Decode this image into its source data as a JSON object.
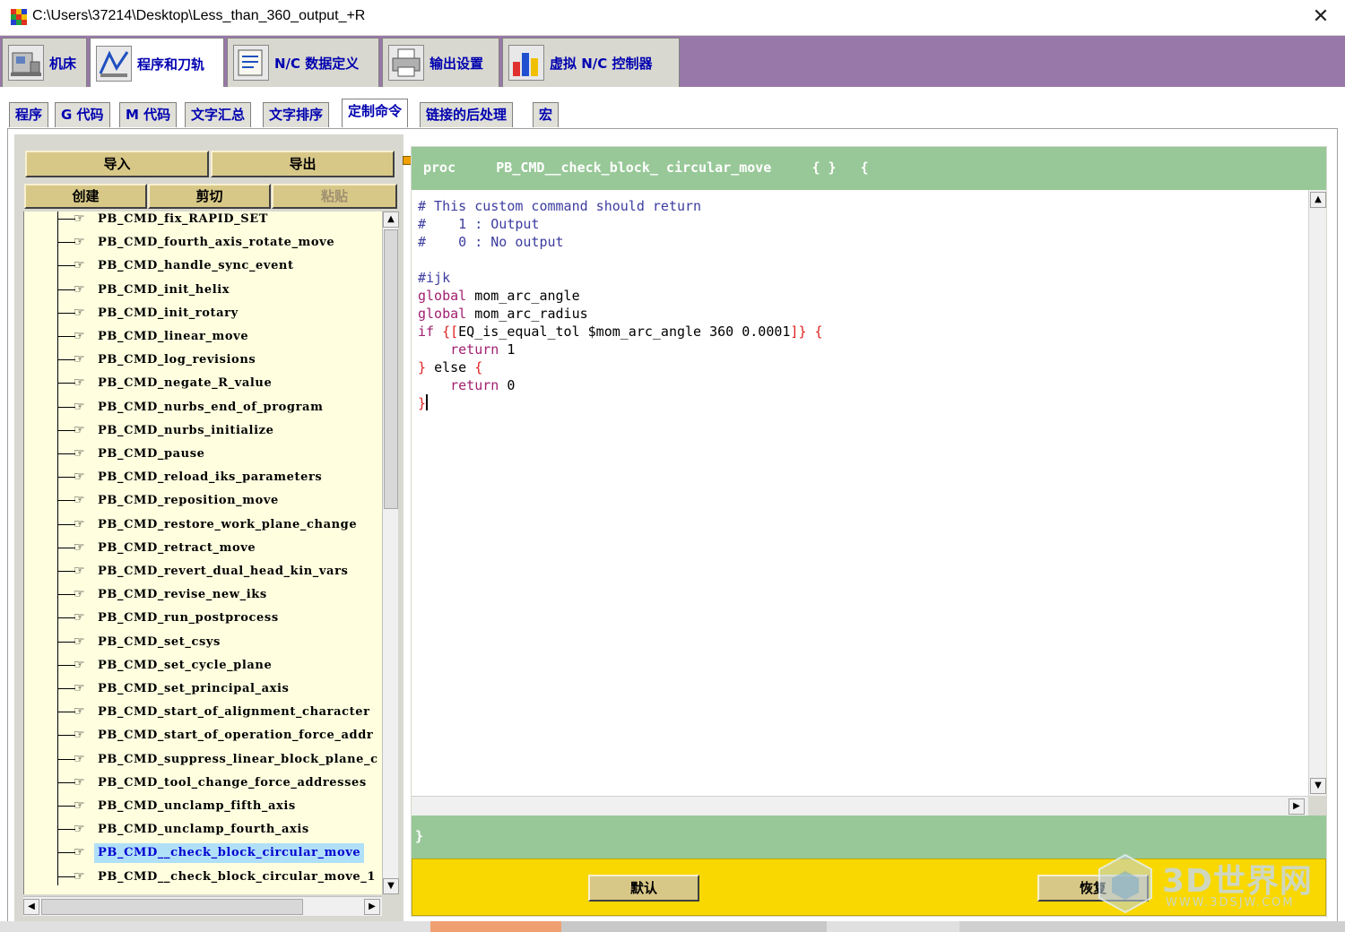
{
  "window": {
    "title": "C:\\Users\\37214\\Desktop\\Less_than_360_output_+R",
    "close_glyph": "✕"
  },
  "main_tabs": [
    {
      "label": "机床",
      "icon": "machine-tool-icon"
    },
    {
      "label": "程序和刀轨",
      "icon": "program-path-icon",
      "active": true
    },
    {
      "label": "N/C 数据定义",
      "icon": "nc-data-icon"
    },
    {
      "label": "输出设置",
      "icon": "printer-icon"
    },
    {
      "label": "虚拟 N/C 控制器",
      "icon": "virtual-controller-icon"
    }
  ],
  "sub_tabs": [
    {
      "label": "程序"
    },
    {
      "label": "G 代码"
    },
    {
      "label": "M 代码"
    },
    {
      "label": "文字汇总"
    },
    {
      "label": "文字排序"
    },
    {
      "label": "定制命令",
      "active": true
    },
    {
      "label": "链接的后处理"
    },
    {
      "label": "宏"
    }
  ],
  "left_panel": {
    "import_label": "导入",
    "export_label": "导出",
    "create_label": "创建",
    "cut_label": "剪切",
    "paste_label": "粘贴",
    "tree_items": [
      "PB_CMD_fix_RAPID_SET",
      "PB_CMD_fourth_axis_rotate_move",
      "PB_CMD_handle_sync_event",
      "PB_CMD_init_helix",
      "PB_CMD_init_rotary",
      "PB_CMD_linear_move",
      "PB_CMD_log_revisions",
      "PB_CMD_negate_R_value",
      "PB_CMD_nurbs_end_of_program",
      "PB_CMD_nurbs_initialize",
      "PB_CMD_pause",
      "PB_CMD_reload_iks_parameters",
      "PB_CMD_reposition_move",
      "PB_CMD_restore_work_plane_change",
      "PB_CMD_retract_move",
      "PB_CMD_revert_dual_head_kin_vars",
      "PB_CMD_revise_new_iks",
      "PB_CMD_run_postprocess",
      "PB_CMD_set_csys",
      "PB_CMD_set_cycle_plane",
      "PB_CMD_set_principal_axis",
      "PB_CMD_start_of_alignment_character",
      "PB_CMD_start_of_operation_force_addr",
      "PB_CMD_suppress_linear_block_plane_c",
      "PB_CMD_tool_change_force_addresses",
      "PB_CMD_unclamp_fifth_axis",
      "PB_CMD_unclamp_fourth_axis",
      "PB_CMD__check_block_circular_move",
      "PB_CMD__check_block_circular_move_1"
    ],
    "selected_index": 27
  },
  "editor": {
    "header": "proc     PB_CMD__check_block_ circular_move     { }   {",
    "lines": [
      {
        "parts": [
          {
            "t": "# This custom command should return",
            "c": "c-comment"
          }
        ]
      },
      {
        "parts": [
          {
            "t": "#    1 : Output",
            "c": "c-comment"
          }
        ]
      },
      {
        "parts": [
          {
            "t": "#    0 : No output",
            "c": "c-comment"
          }
        ]
      },
      {
        "parts": [
          {
            "t": "",
            "c": "c-var"
          }
        ]
      },
      {
        "parts": [
          {
            "t": "#ijk",
            "c": "c-comment"
          }
        ]
      },
      {
        "parts": [
          {
            "t": "global ",
            "c": "c-kw"
          },
          {
            "t": "mom_arc_angle",
            "c": "c-var"
          }
        ]
      },
      {
        "parts": [
          {
            "t": "global ",
            "c": "c-kw"
          },
          {
            "t": "mom_arc_radius",
            "c": "c-var"
          }
        ]
      },
      {
        "parts": [
          {
            "t": "if ",
            "c": "c-kw"
          },
          {
            "t": "{[",
            "c": "c-brace"
          },
          {
            "t": "EQ_is_equal_tol $mom_arc_angle 360 0.0001",
            "c": "c-var"
          },
          {
            "t": "]} {",
            "c": "c-brace"
          }
        ]
      },
      {
        "parts": [
          {
            "t": "    return ",
            "c": "c-kw"
          },
          {
            "t": "1",
            "c": "c-num"
          }
        ]
      },
      {
        "parts": [
          {
            "t": "} ",
            "c": "c-brace"
          },
          {
            "t": "else ",
            "c": "c-var"
          },
          {
            "t": "{",
            "c": "c-brace"
          }
        ]
      },
      {
        "parts": [
          {
            "t": "    return ",
            "c": "c-kw"
          },
          {
            "t": "0",
            "c": "c-num"
          }
        ]
      },
      {
        "parts": [
          {
            "t": "}",
            "c": "c-brace"
          }
        ],
        "cursor": true
      }
    ],
    "footer": "}"
  },
  "bottom_buttons": {
    "default_label": "默认",
    "restore_label": "恢复"
  },
  "watermark": {
    "text": "3D世界网",
    "sub": "WWW.3DSJW.COM"
  },
  "colors": {
    "top_band": "#9878a8",
    "header_green": "#98c898",
    "bottom_yellow": "#f8d800",
    "tree_bg": "#ffffe0",
    "tab_text": "#0000b0",
    "selection": "#b0e0f8"
  }
}
